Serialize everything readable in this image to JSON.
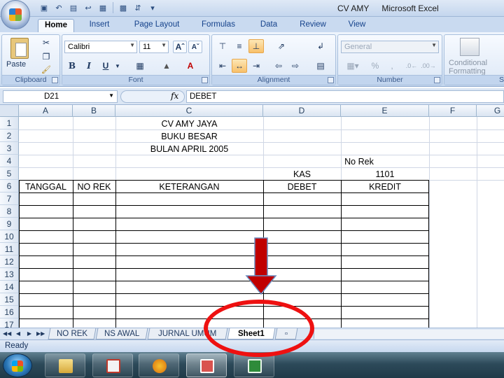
{
  "window": {
    "title_doc": "CV AMY",
    "title_app": "Microsoft Excel"
  },
  "ribbon": {
    "tabs": [
      "Home",
      "Insert",
      "Page Layout",
      "Formulas",
      "Data",
      "Review",
      "View"
    ],
    "active_tab": "Home",
    "clipboard": {
      "label": "Clipboard",
      "paste": "Paste"
    },
    "font": {
      "label": "Font",
      "name": "Calibri",
      "size": "11",
      "bold": "B",
      "italic": "I",
      "underline": "U"
    },
    "alignment": {
      "label": "Alignment"
    },
    "number": {
      "label": "Number",
      "format": "General",
      "percent": "%"
    },
    "styles": {
      "conditional_line1": "Conditional",
      "conditional_line2": "Formatting",
      "label": "S"
    }
  },
  "formula_bar": {
    "name_box": "D21",
    "fx": "fx",
    "formula": "DEBET"
  },
  "grid": {
    "columns": [
      "A",
      "B",
      "C",
      "D",
      "E",
      "F",
      "G"
    ],
    "rows": [
      "1",
      "2",
      "3",
      "4",
      "5",
      "6",
      "7",
      "8",
      "9",
      "10",
      "11",
      "12",
      "13",
      "14",
      "15",
      "16",
      "17"
    ],
    "cells": {
      "company": "CV AMY JAYA",
      "book": "BUKU BESAR",
      "period": "BULAN APRIL 2005",
      "no_rek_label": "No Rek",
      "account_name": "KAS",
      "account_no": "1101",
      "headers": [
        "TANGGAL",
        "NO REK",
        "KETERANGAN",
        "DEBET",
        "KREDIT"
      ]
    }
  },
  "sheets": {
    "tabs": [
      "NO REK",
      "NS AWAL",
      "JURNAL UMUM",
      "Sheet1"
    ],
    "active": "Sheet1"
  },
  "status": {
    "text": "Ready"
  },
  "annotation_colors": {
    "arrow": "#c00000",
    "circle": "#ee1111"
  },
  "taskbar": {
    "icons": [
      "start-orb-icon",
      "folder-icon",
      "powerpoint-icon",
      "media-player-icon",
      "powerpoint-active-icon",
      "excel-icon"
    ]
  }
}
